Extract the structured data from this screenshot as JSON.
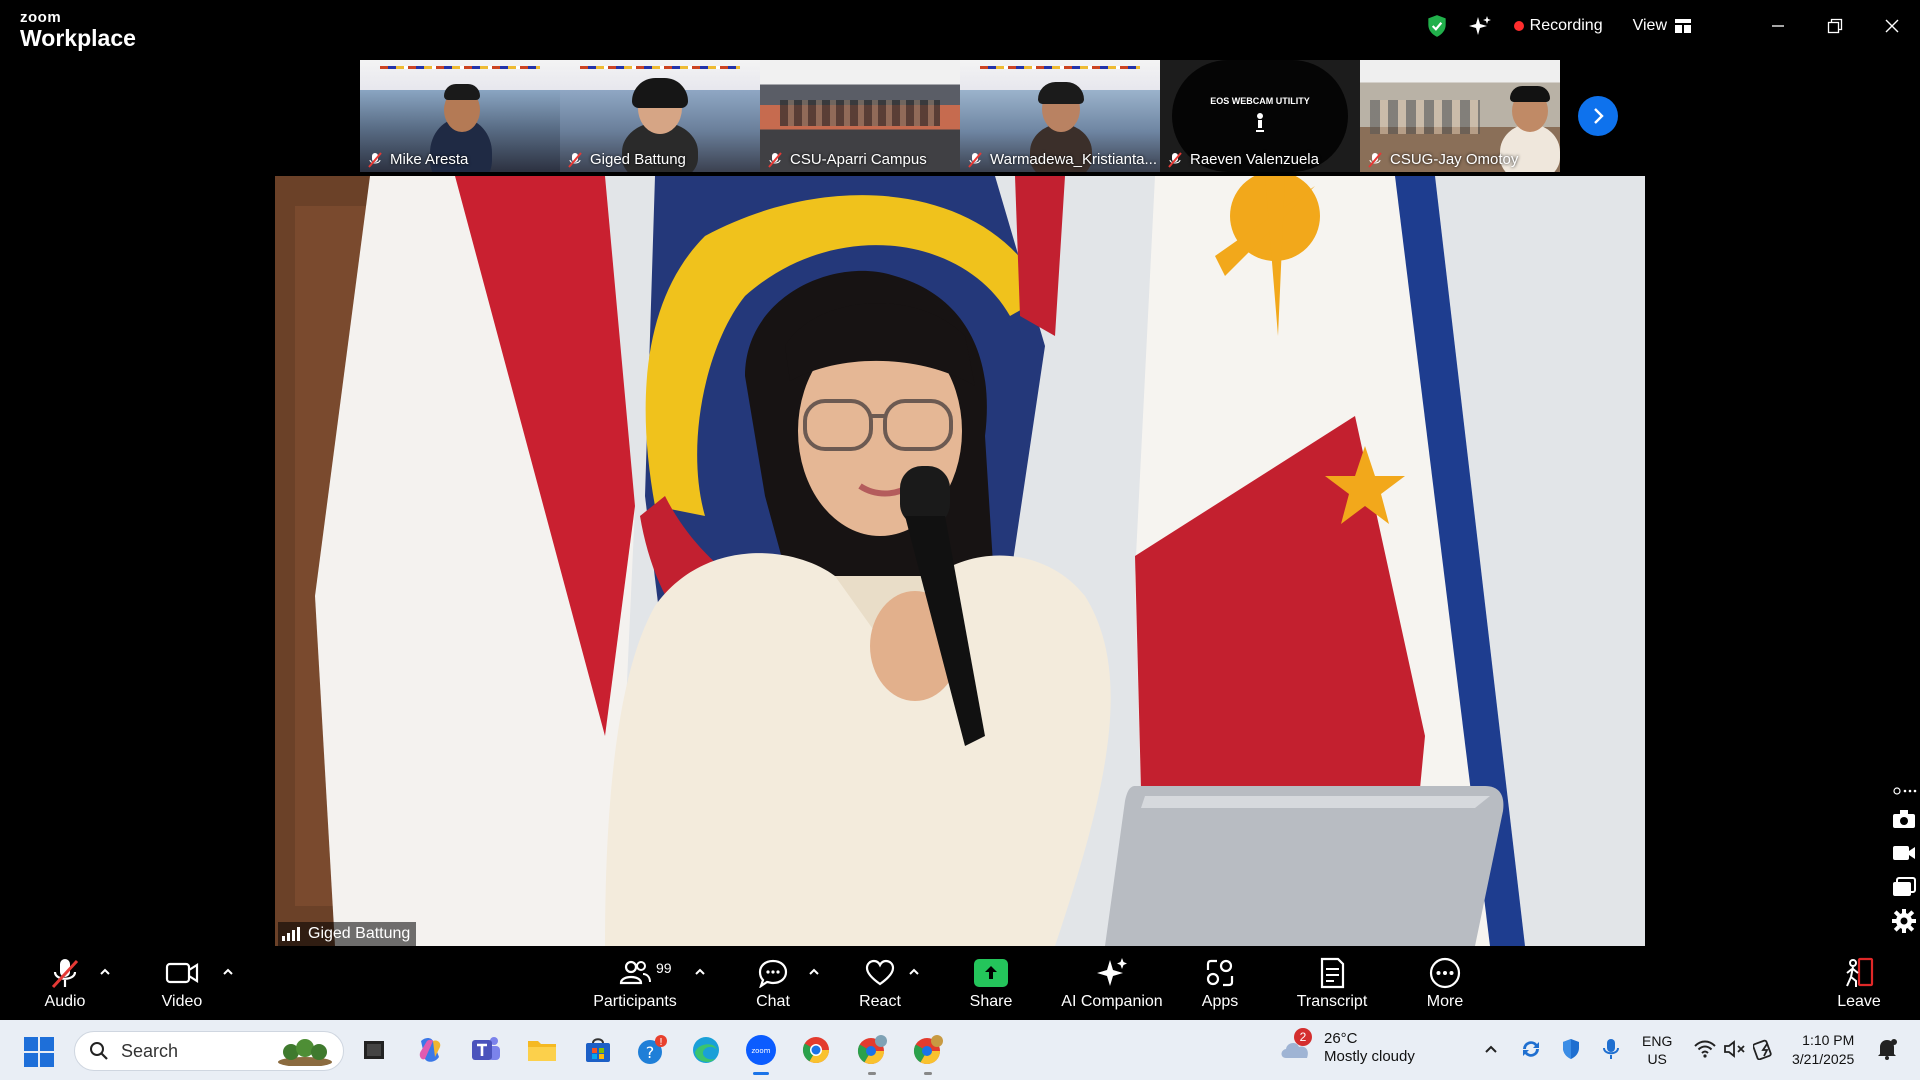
{
  "app": {
    "brand_top": "zoom",
    "brand_bottom": "Workplace"
  },
  "titlebar": {
    "recording_label": "Recording",
    "view_label": "View"
  },
  "filmstrip": {
    "participants": [
      {
        "name": "Mike Aresta",
        "muted": true
      },
      {
        "name": "Giged Battung",
        "muted": true
      },
      {
        "name": "CSU-Aparri Campus",
        "muted": true
      },
      {
        "name": "Warmadewa_Kristianta...",
        "muted": true
      },
      {
        "name": "Raeven Valenzuela",
        "muted": true,
        "video_text": "EOS WEBCAM UTILITY"
      },
      {
        "name": "CSUG-Jay Omotoy",
        "muted": true
      }
    ]
  },
  "main_video": {
    "speaker_name": "Giged Battung"
  },
  "toolbar": {
    "audio": "Audio",
    "video": "Video",
    "participants": "Participants",
    "participants_count": "99",
    "chat": "Chat",
    "react": "React",
    "share": "Share",
    "ai_companion": "AI Companion",
    "apps": "Apps",
    "transcript": "Transcript",
    "more": "More",
    "leave": "Leave"
  },
  "taskbar": {
    "search_placeholder": "Search",
    "weather": {
      "temp": "26°C",
      "condition": "Mostly cloudy",
      "alert_count": "2"
    },
    "language": {
      "line1": "ENG",
      "line2": "US"
    },
    "clock": {
      "time": "1:10 PM",
      "date": "3/21/2025"
    }
  },
  "colors": {
    "accent_blue": "#0e72ed",
    "share_green": "#24c55b",
    "recording_red": "#ff2d2d",
    "leave_red": "#e02828"
  }
}
